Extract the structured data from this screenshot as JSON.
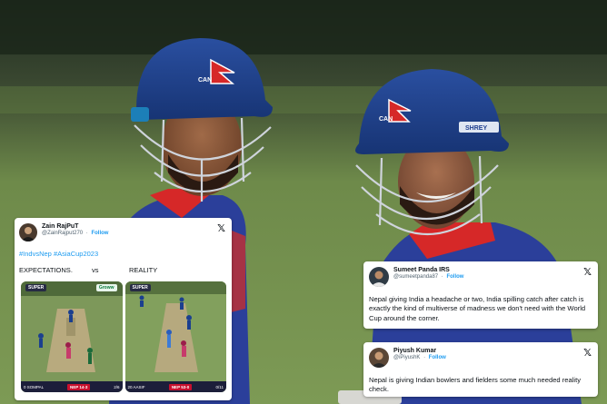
{
  "tweets": [
    {
      "name": "Zain RajPuT",
      "handle": "@ZainRajput270",
      "follow": "Follow",
      "hashtags": "#IndvsNep #AsiaCup2023",
      "expectations": "EXPECTATIONS.",
      "vs": "vs",
      "reality": "REALITY",
      "media": {
        "left": {
          "tag": "SUPER",
          "badge": "Groww",
          "score": "NEP 14-3",
          "left_info": "0  SOMPAL",
          "right_info": "2/6"
        },
        "right": {
          "tag": "SUPER",
          "score": "NEP 53-0",
          "left_info": "20  AASIF",
          "right_info": "0/11"
        }
      }
    },
    {
      "name": "Sumeet Panda IRS",
      "handle": "@sumeetpanda87",
      "follow": "Follow",
      "text": "Nepal giving India a headache or two, India spilling catch after catch is exactly the kind of multiverse of madness we don't need with the World Cup around the corner."
    },
    {
      "name": "Piyush Kumar",
      "handle": "@iPiyushK",
      "follow": "Follow",
      "text": "Nepal is giving Indian bowlers and fielders some much needed reality check."
    }
  ],
  "icons": {
    "x_logo": "x-logo-icon"
  },
  "helmet_text": {
    "badge": "CAN",
    "brand": "SHREY"
  },
  "colors": {
    "follow": "#1d9bf0",
    "helmet": "#1f3f8f",
    "jersey_red": "#d62828"
  }
}
